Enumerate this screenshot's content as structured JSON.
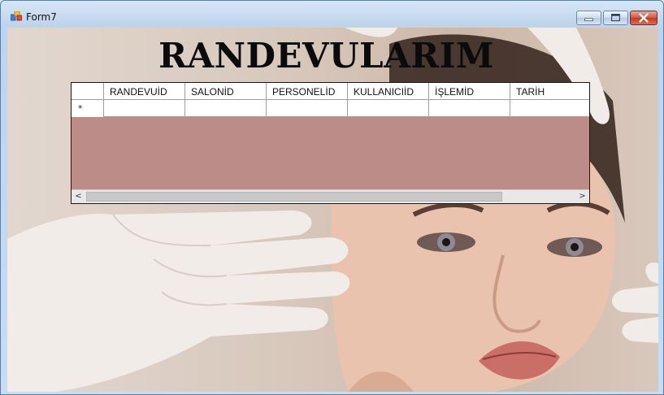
{
  "window": {
    "title": "Form7",
    "controls": {
      "minimize": "minimize-icon",
      "maximize": "maximize-icon",
      "close": "close-icon"
    }
  },
  "heading": "RANDEVULARIM",
  "grid": {
    "columns": [
      "RANDEVUİD",
      "SALONİD",
      "PERSONELİD",
      "KULLANICIİD",
      "İŞLEMİD",
      "TARİH"
    ],
    "new_row_marker": "*",
    "rows": [],
    "background_color": "#bc8c89",
    "scrollbar": {
      "left_arrow": "<",
      "right_arrow": ">"
    }
  },
  "background_image": "woman-face-with-gloved-hands"
}
